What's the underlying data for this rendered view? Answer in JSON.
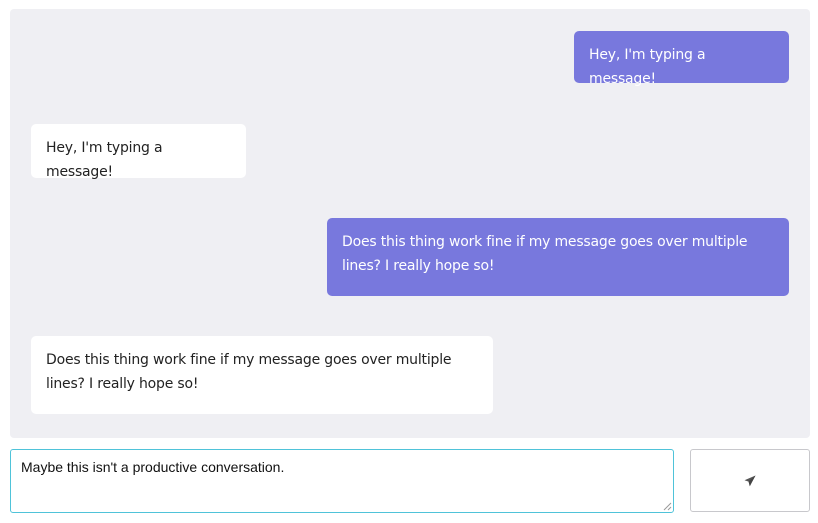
{
  "messages": [
    {
      "direction": "outgoing",
      "text": "Hey, I'm typing a message!"
    },
    {
      "direction": "incoming",
      "text": "Hey, I'm typing a message!"
    },
    {
      "direction": "outgoing",
      "text": "Does this thing work fine if my message goes over multiple lines? I really hope so!"
    },
    {
      "direction": "incoming",
      "text": "Does this thing work fine if my message goes over multiple lines? I really hope so!"
    }
  ],
  "composer": {
    "input_value": "Maybe this isn't a productive conversation.",
    "send_icon": "paper-plane-icon"
  },
  "colors": {
    "outgoing_bubble": "#7878dd",
    "incoming_bubble": "#ffffff",
    "chat_background": "#efeff3",
    "input_focus_border": "#4fc3d9"
  }
}
